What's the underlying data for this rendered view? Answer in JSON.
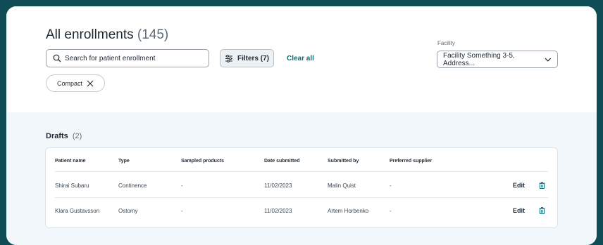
{
  "header": {
    "title": "All enrollments",
    "count": "(145)"
  },
  "search": {
    "placeholder": "Search for patient enrollment"
  },
  "filters": {
    "label": "Filters (7)",
    "clear_label": "Clear all"
  },
  "facility": {
    "label": "Facility",
    "value": "Facility Something 3-5, Address..."
  },
  "chip": {
    "label": "Compact"
  },
  "drafts": {
    "title": "Drafts",
    "count": "(2)",
    "columns": [
      "Patient name",
      "Type",
      "Sampled products",
      "Date submitted",
      "Submitted by",
      "Preferred supplier"
    ],
    "rows": [
      {
        "patient": "Shirai Subaru",
        "type": "Continence",
        "sampled": "-",
        "date": "11/02/2023",
        "submitted_by": "Malin Quist",
        "supplier": "-",
        "edit": "Edit"
      },
      {
        "patient": "Klara Gustavsson",
        "type": "Ostomy",
        "sampled": "-",
        "date": "11/02/2023",
        "submitted_by": "Artem Horbenko",
        "supplier": "-",
        "edit": "Edit"
      }
    ]
  },
  "colors": {
    "accent": "#0b6f7a",
    "frame": "#0f4c55",
    "panel": "#f1f7fa"
  },
  "icons": {
    "search": "search-icon",
    "filters": "sliders-icon",
    "dropdown": "chevron-down-icon",
    "chip_close": "close-icon",
    "delete": "trash-icon"
  }
}
